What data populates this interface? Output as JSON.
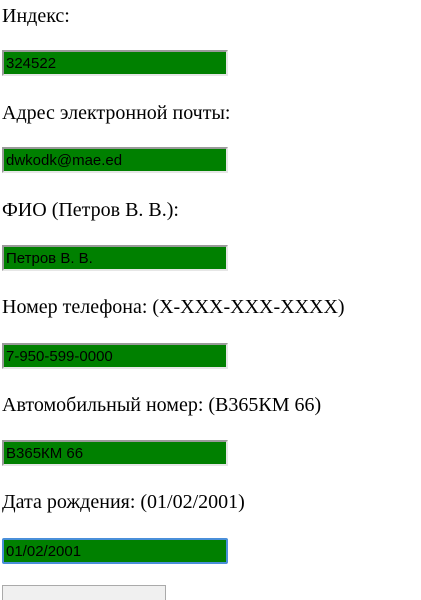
{
  "form": {
    "fields": [
      {
        "label": "Индекс:",
        "value": "324522"
      },
      {
        "label": "Адрес электронной почты:",
        "value": "dwkodk@mae.ed"
      },
      {
        "label": "ФИО (Петров В. В.):",
        "value": "Петров В. В."
      },
      {
        "label": "Номер телефона: (X-XXX-XXX-XXXX)",
        "value": "7-950-599-0000"
      },
      {
        "label": "Автомобильный номер: (В365КМ 66)",
        "value": "В365КМ 66"
      },
      {
        "label": "Дата рождения: (01/02/2001)",
        "value": "01/02/2001"
      }
    ]
  },
  "colors": {
    "valid_field_bg": "#008000",
    "focus_border": "#4a8fd9"
  }
}
